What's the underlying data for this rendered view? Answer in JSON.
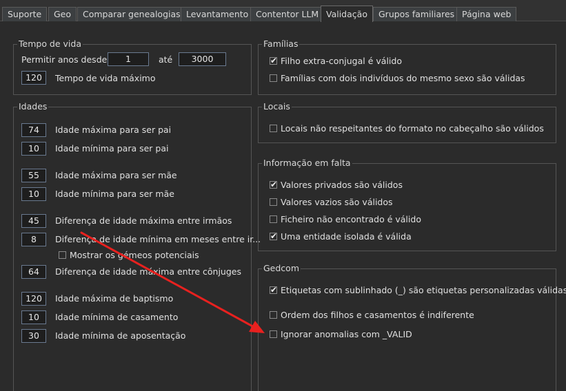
{
  "tabs": [
    {
      "label": "Suporte",
      "active": false
    },
    {
      "label": "Geo",
      "active": false
    },
    {
      "label": "Comparar genealogias",
      "active": false
    },
    {
      "label": "Levantamento",
      "active": false
    },
    {
      "label": "Contentor LLM",
      "active": false
    },
    {
      "label": "Validação",
      "active": true
    },
    {
      "label": "Grupos familiares",
      "active": false
    },
    {
      "label": "Página web",
      "active": false
    }
  ],
  "lifetime": {
    "title": "Tempo de vida",
    "allow_years_label": "Permitir anos desde",
    "from_value": "1",
    "to_label": "até",
    "to_value": "3000",
    "max_lifetime_value": "120",
    "max_lifetime_label": "Tempo de vida máximo"
  },
  "ages": {
    "title": "Idades",
    "rows": [
      {
        "value": "74",
        "label": "Idade máxima para ser pai"
      },
      {
        "value": "10",
        "label": "Idade mínima para ser pai"
      },
      {
        "value": "55",
        "label": "Idade máxima para ser mãe"
      },
      {
        "value": "10",
        "label": "Idade mínima para ser mãe"
      },
      {
        "value": "45",
        "label": "Diferença de idade máxima entre irmãos"
      },
      {
        "value": "8",
        "label": "Diferença de idade mínima em meses entre ir..."
      },
      {
        "value": "64",
        "label": "Diferença de idade máxima entre cônjuges"
      },
      {
        "value": "120",
        "label": "Idade máxima de baptismo"
      },
      {
        "value": "10",
        "label": "Idade mínima de casamento"
      },
      {
        "value": "30",
        "label": "Idade mínima de aposentação"
      }
    ],
    "twins_checkbox": {
      "label": "Mostrar os gémeos potenciais",
      "checked": false
    }
  },
  "families": {
    "title": "Famílias",
    "items": [
      {
        "label": "Filho extra-conjugal é válido",
        "checked": true
      },
      {
        "label": "Famílias com dois indivíduos do mesmo sexo são válidas",
        "checked": false
      }
    ]
  },
  "places": {
    "title": "Locais",
    "items": [
      {
        "label": "Locais não respeitantes do formato no cabeçalho são válidos",
        "checked": false
      }
    ]
  },
  "missing": {
    "title": "Informação em falta",
    "items": [
      {
        "label": "Valores privados são válidos",
        "checked": true
      },
      {
        "label": "Valores vazios são válidos",
        "checked": false
      },
      {
        "label": "Ficheiro não encontrado é válido",
        "checked": false
      },
      {
        "label": "Uma entidade isolada é válida",
        "checked": true
      }
    ]
  },
  "gedcom": {
    "title": "Gedcom",
    "items": [
      {
        "label": "Etiquetas com sublinhado (_) são etiquetas personalizadas válidas",
        "checked": true
      },
      {
        "label": "Ordem dos filhos e casamentos é indiferente",
        "checked": false
      },
      {
        "label": "Ignorar anomalias com _VALID",
        "checked": false
      }
    ]
  },
  "colors": {
    "annotation_arrow": "#e8211f"
  }
}
